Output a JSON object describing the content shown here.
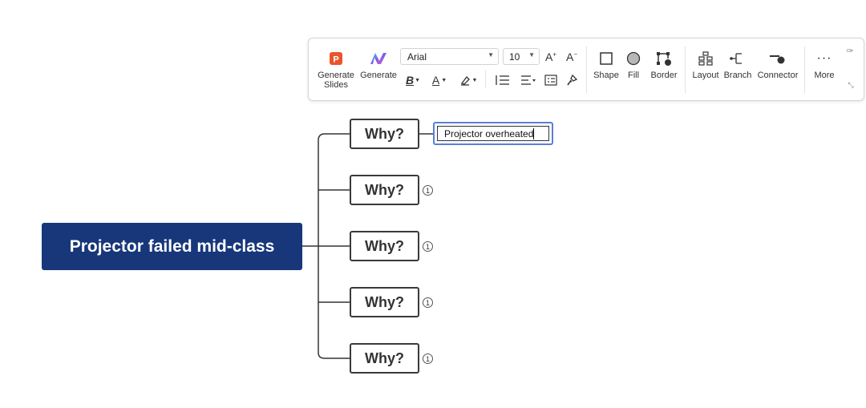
{
  "toolbar": {
    "generate_slides_label": "Generate\nSlides",
    "generate_label": "Generate",
    "font_family": "Arial",
    "font_size": "10",
    "shape_label": "Shape",
    "fill_label": "Fill",
    "border_label": "Border",
    "layout_label": "Layout",
    "branch_label": "Branch",
    "connector_label": "Connector",
    "more_label": "More"
  },
  "mindmap": {
    "root": "Projector failed mid-class",
    "branches": [
      {
        "label": "Why?",
        "child_text": "Projector overheated"
      },
      {
        "label": "Why?",
        "badge": "1"
      },
      {
        "label": "Why?",
        "badge": "1"
      },
      {
        "label": "Why?",
        "badge": "1"
      },
      {
        "label": "Why?",
        "badge": "1"
      }
    ]
  },
  "colors": {
    "root_bg": "#17377a",
    "edit_border": "#5b7fd6",
    "slides_icon": "#e8552b"
  }
}
